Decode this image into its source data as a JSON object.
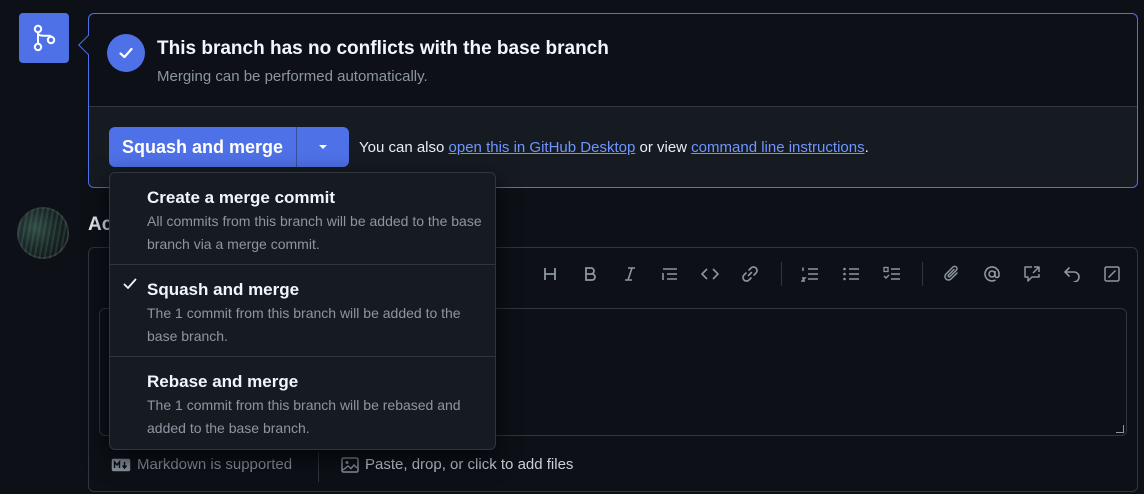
{
  "merge_status": {
    "title": "This branch has no conflicts with the base branch",
    "subtitle": "Merging can be performed automatically."
  },
  "merge_action": {
    "button_label": "Squash and merge",
    "also_prefix": "You can also",
    "desktop_link": "open this in GitHub Desktop",
    "middle_text": "or view",
    "cli_link": "command line instructions",
    "suffix": "."
  },
  "dropdown": {
    "items": [
      {
        "title": "Create a merge commit",
        "description": "All commits from this branch will be added to the base branch via a merge commit.",
        "selected": false
      },
      {
        "title": "Squash and merge",
        "description": "The 1 commit from this branch will be added to the base branch.",
        "selected": true
      },
      {
        "title": "Rebase and merge",
        "description": "The 1 commit from this branch will be rebased and added to the base branch.",
        "selected": false
      }
    ]
  },
  "comment": {
    "heading_partial": "Ac",
    "toolbar_icons": [
      "heading-icon",
      "bold-icon",
      "italic-icon",
      "quote-icon",
      "code-icon",
      "link-icon",
      "numbered-list-icon",
      "bulleted-list-icon",
      "task-list-icon",
      "attach-icon",
      "mention-icon",
      "reference-icon",
      "undo-icon",
      "fullscreen-icon"
    ],
    "markdown_note": "Markdown is supported",
    "files_note": "Paste, drop, or click to add files"
  },
  "colors": {
    "accent": "#4f71e7",
    "link": "#6f95ff",
    "background": "#0d1117",
    "panel": "#161b22",
    "border": "#30363d",
    "muted_text": "#8d96a0"
  }
}
